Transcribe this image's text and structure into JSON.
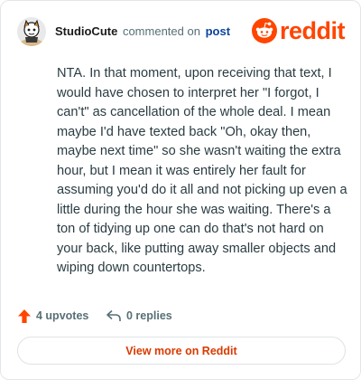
{
  "header": {
    "username": "StudioCute",
    "verb": "commented on",
    "target_link": "post",
    "brand": "reddit"
  },
  "comment": {
    "text": "NTA. In that moment, upon receiving that text, I would have chosen to interpret her \"I forgot, I can't\" as cancellation of the whole deal. I mean maybe I'd have texted back \"Oh, okay then, maybe next time\" so she wasn't waiting the extra hour, but I mean it was entirely her fault for assuming you'd do it all and not picking up even a little during the hour she was waiting. There's a ton of tidying up one can do that's not hard on your back, like putting away smaller objects and wiping down countertops."
  },
  "footer": {
    "upvotes_label": "4 upvotes",
    "replies_label": "0 replies",
    "cta_label": "View more on Reddit"
  },
  "colors": {
    "brand": "#ff4500",
    "link": "#0a449b",
    "cta_text": "#d93a00",
    "muted": "#576f76"
  },
  "icons": {
    "avatar": "snoo-avatar",
    "logo": "reddit-snoo-icon",
    "upvote": "upvote-arrow-icon",
    "reply": "reply-arrow-icon"
  }
}
